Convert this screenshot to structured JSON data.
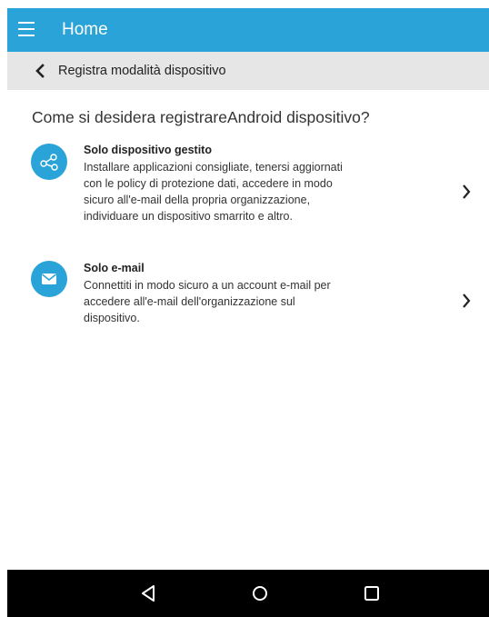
{
  "app_bar": {
    "title": "Home",
    "menu_icon": "hamburger-menu-icon"
  },
  "sub_bar": {
    "back_icon": "chevron-left-icon",
    "title": "Registra modalità dispositivo"
  },
  "question": "Come si desidera registrareAndroid dispositivo?",
  "options": [
    {
      "icon": "share-icon",
      "title": "Solo dispositivo gestito",
      "lines": [
        "Installare applicazioni consigliate, tenersi aggiornati",
        "con le policy di protezione dati, accedere in modo",
        "sicuro all'e-mail della propria organizzazione,",
        "individuare un dispositivo smarrito e altro."
      ],
      "chevron_icon": "chevron-right-icon"
    },
    {
      "icon": "envelope-icon",
      "title": "Solo e-mail",
      "lines": [
        "Connettiti in modo sicuro a un account e-mail per",
        "accedere all'e-mail dell'organizzazione sul",
        "dispositivo."
      ],
      "chevron_icon": "chevron-right-icon"
    }
  ],
  "nav_bar": {
    "back_icon": "nav-back-triangle-icon",
    "home_icon": "nav-home-circle-icon",
    "recents_icon": "nav-recents-square-icon"
  },
  "colors": {
    "accent": "#2aa3d8",
    "sub_bar_bg": "#e6e6e6",
    "nav_bar_bg": "#000000"
  }
}
